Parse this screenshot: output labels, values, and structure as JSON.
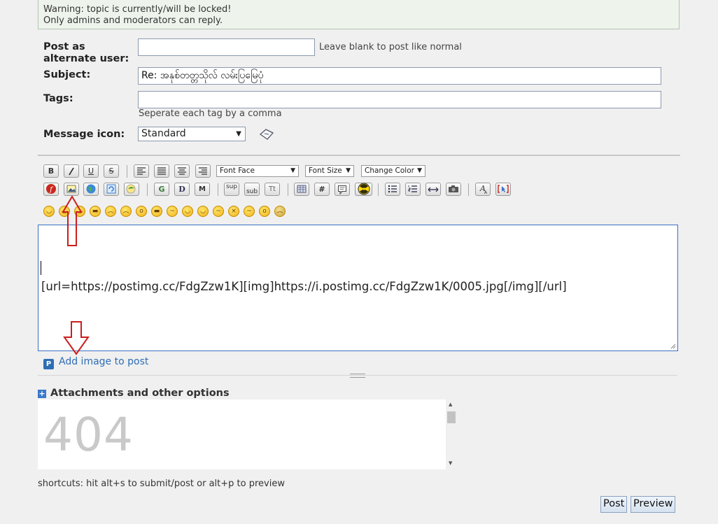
{
  "warning": {
    "line1": "Warning: topic is currently/will be locked!",
    "line2": "Only admins and moderators can reply."
  },
  "form": {
    "alternate_user_label_1": "Post as",
    "alternate_user_label_2": "alternate user:",
    "alternate_user_value": "",
    "alternate_user_hint": "Leave blank to post like normal",
    "subject_label": "Subject:",
    "subject_value": "Re: အနုစ်တတ္တသိုလ် လမ်းပြမြေပုံ",
    "tags_label": "Tags:",
    "tags_value": "",
    "tags_hint": "Seperate each tag by a comma",
    "message_icon_label": "Message icon:",
    "message_icon_value": "Standard"
  },
  "toolbar": {
    "bold": "B",
    "italic": "I",
    "underline": "U",
    "strike": "S",
    "font_face": "Font Face",
    "font_size": "Font Size",
    "change_color": "Change Color",
    "google": "G",
    "dict": "D",
    "maps": "M",
    "sup": "sup",
    "sub": "sub",
    "tt": "Tt",
    "hash": "#"
  },
  "editor": {
    "content": "[url=https://postimg.cc/FdgZzw1K][img]https://i.postimg.cc/FdgZzw1K/0005.jpg[/img][/url]"
  },
  "add_image": {
    "icon_letter": "P",
    "label": "Add image to post"
  },
  "attachments": {
    "title": "Attachments and other options",
    "frame_text": "404"
  },
  "shortcuts": "shortcuts: hit alt+s to submit/post or alt+p to preview",
  "buttons": {
    "post": "Post",
    "preview": "Preview"
  },
  "colors": {
    "accent_blue": "#2e6eb5",
    "editor_border": "#3a6fc4",
    "annotation_red": "#cc1e1e",
    "warning_bg": "#eef4ec"
  }
}
